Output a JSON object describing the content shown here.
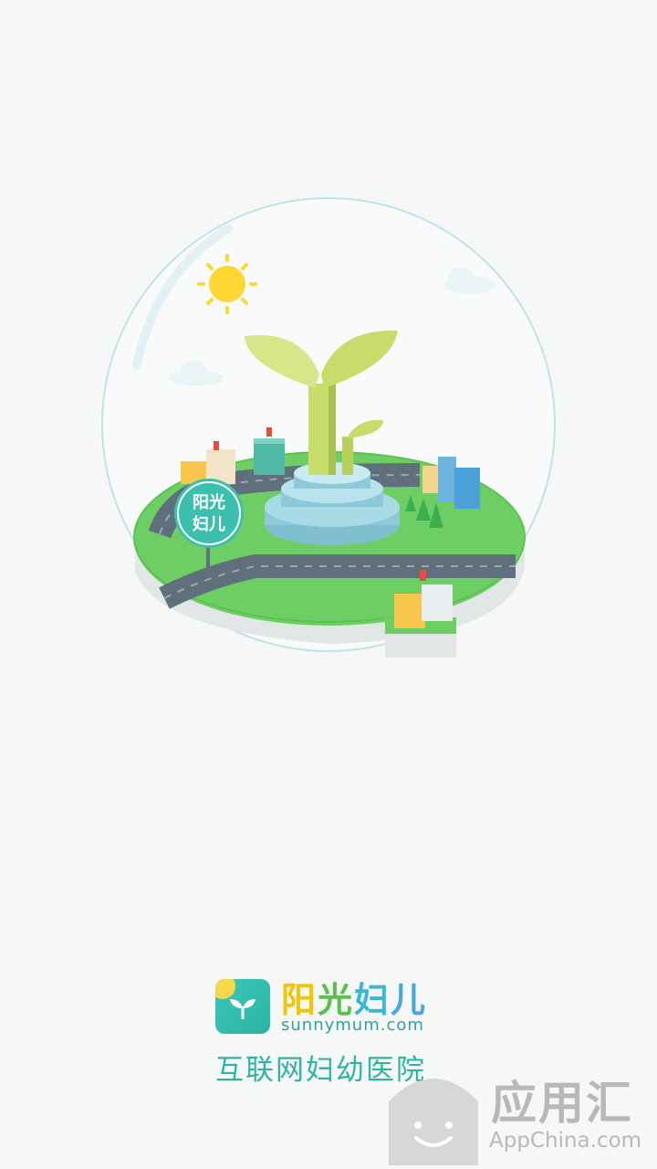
{
  "splash": {
    "sign_line1": "阳光",
    "sign_line2": "妇儿"
  },
  "brand": {
    "name_chars": [
      "阳",
      "光",
      "妇",
      "儿"
    ],
    "domain": "sunnymum.com",
    "slogan": "互联网妇幼医院",
    "accent_color": "#2fb3a3"
  },
  "watermark": {
    "text": "应用汇",
    "domain": "AppChina.com"
  }
}
